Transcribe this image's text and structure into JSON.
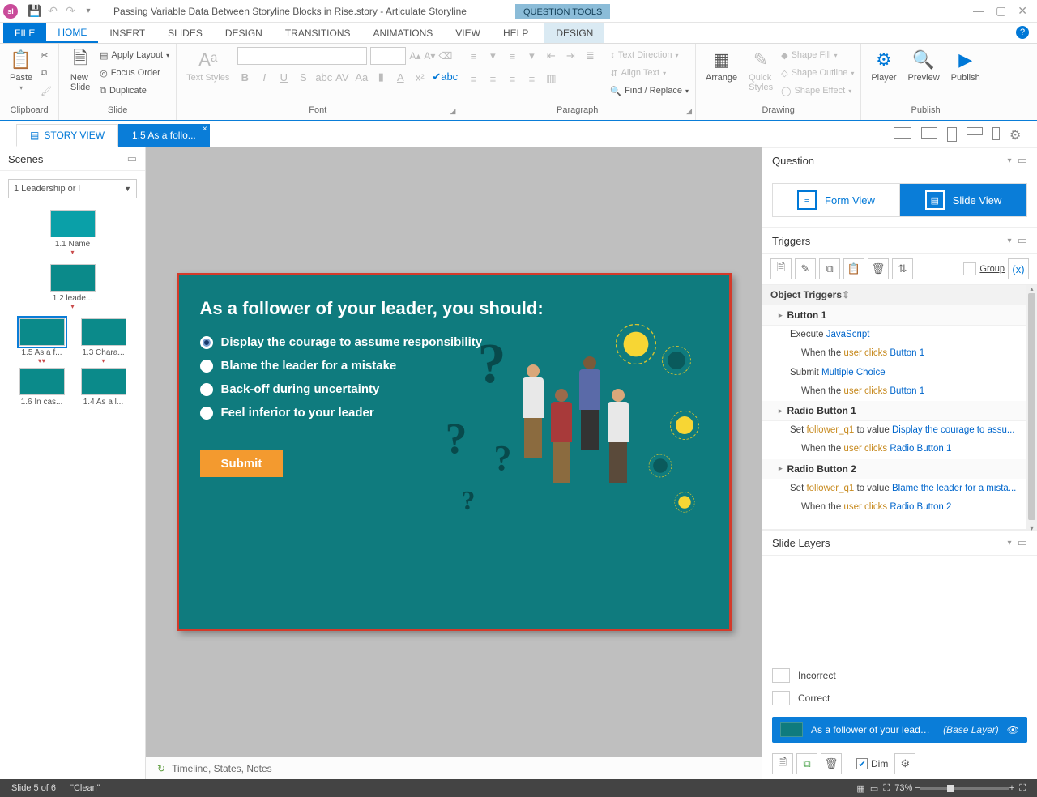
{
  "titlebar": {
    "app_badge": "sl",
    "doc_title": "Passing Variable Data Between Storyline Blocks in Rise.story  -  Articulate Storyline",
    "context_tab": "QUESTION TOOLS"
  },
  "ribbon_tabs": {
    "file": "FILE",
    "home": "HOME",
    "insert": "INSERT",
    "slides": "SLIDES",
    "design": "DESIGN",
    "transitions": "TRANSITIONS",
    "animations": "ANIMATIONS",
    "view": "VIEW",
    "help": "HELP",
    "ctx_design": "DESIGN"
  },
  "ribbon": {
    "clipboard": {
      "paste": "Paste",
      "label": "Clipboard"
    },
    "slide": {
      "new_slide": "New\nSlide",
      "apply_layout": "Apply Layout",
      "focus_order": "Focus Order",
      "duplicate": "Duplicate",
      "label": "Slide"
    },
    "font": {
      "text_styles": "Text Styles",
      "label": "Font"
    },
    "paragraph": {
      "text_direction": "Text Direction",
      "align_text": "Align Text",
      "find_replace": "Find / Replace",
      "label": "Paragraph"
    },
    "drawing": {
      "arrange": "Arrange",
      "quick_styles": "Quick\nStyles",
      "shape_fill": "Shape Fill",
      "shape_outline": "Shape Outline",
      "shape_effect": "Shape Effect",
      "label": "Drawing"
    },
    "publish": {
      "player": "Player",
      "preview": "Preview",
      "publish": "Publish",
      "label": "Publish"
    }
  },
  "viewstrip": {
    "story_view": "STORY VIEW",
    "slide_tab": "1.5 As a follo..."
  },
  "scenes": {
    "header": "Scenes",
    "selector": "1 Leadership or l",
    "thumbs": [
      {
        "caption": "1.1 Name"
      },
      {
        "caption": "1.2 leade..."
      },
      {
        "caption": "1.5 As a f..."
      },
      {
        "caption": "1.3 Chara..."
      },
      {
        "caption": "1.6 In cas..."
      },
      {
        "caption": "1.4 As a l..."
      }
    ]
  },
  "slide": {
    "title": "As a follower of your leader, you should:",
    "options": [
      "Display the courage to assume responsibility",
      "Blame the leader for a mistake",
      "Back-off during uncertainty",
      "Feel inferior to your leader"
    ],
    "submit": "Submit"
  },
  "timeline": {
    "label": "Timeline, States, Notes"
  },
  "question_panel": {
    "header": "Question",
    "form_view": "Form View",
    "slide_view": "Slide View"
  },
  "triggers_panel": {
    "header": "Triggers",
    "group_label": "Group",
    "section": "Object Triggers",
    "items": [
      {
        "name": "Button 1",
        "lines": [
          {
            "pre": "Execute ",
            "link": "JavaScript"
          },
          {
            "sub": true,
            "pre": "When the ",
            "var": "user clicks",
            "post": " ",
            "link": "Button 1"
          },
          {
            "pre": "Submit ",
            "link": "Multiple Choice"
          },
          {
            "sub": true,
            "pre": "When the ",
            "var": "user clicks",
            "post": " ",
            "link": "Button 1"
          }
        ]
      },
      {
        "name": "Radio Button 1",
        "lines": [
          {
            "pre": "Set ",
            "var": "follower_q1",
            "post": " to value ",
            "link": "Display the courage to assu..."
          },
          {
            "sub": true,
            "pre": "When the ",
            "var": "user clicks",
            "post": " ",
            "link": "Radio Button 1"
          }
        ]
      },
      {
        "name": "Radio Button 2",
        "lines": [
          {
            "pre": "Set ",
            "var": "follower_q1",
            "post": " to value ",
            "link": "Blame the leader for a mista..."
          },
          {
            "sub": true,
            "pre": "When the ",
            "var": "user clicks",
            "post": " ",
            "link": "Radio Button 2"
          }
        ]
      }
    ]
  },
  "layers_panel": {
    "header": "Slide Layers",
    "incorrect": "Incorrect",
    "correct": "Correct",
    "base_name": "As a follower of your leader, yo...",
    "base_suffix": "(Base Layer)",
    "dim": "Dim"
  },
  "status": {
    "slide": "Slide 5 of 6",
    "layout": "\"Clean\"",
    "zoom": "73%"
  }
}
